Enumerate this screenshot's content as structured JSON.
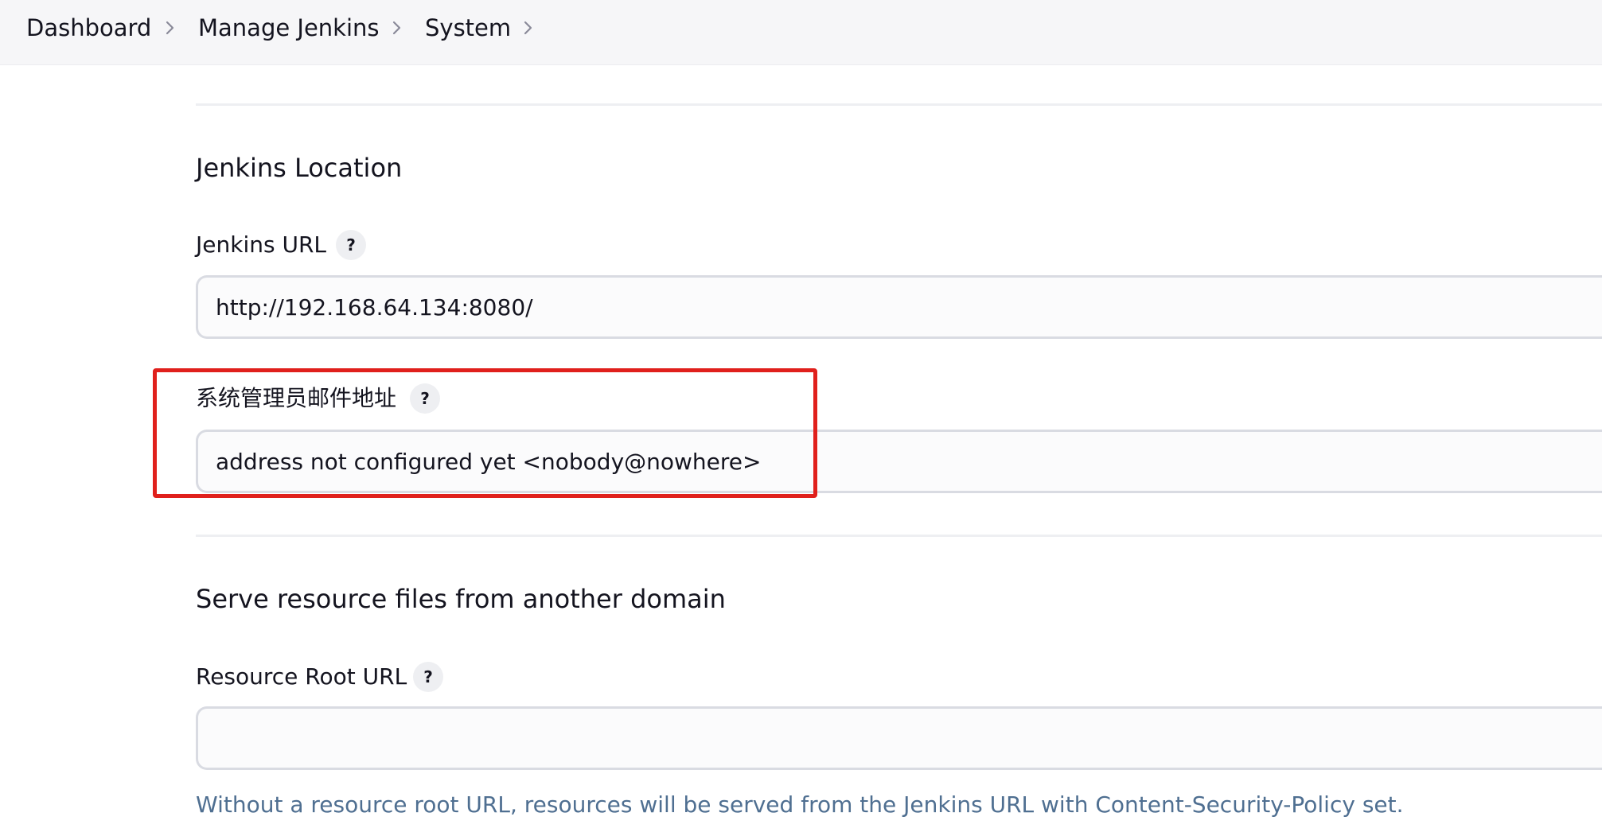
{
  "breadcrumb": {
    "items": [
      {
        "label": "Dashboard"
      },
      {
        "label": "Manage Jenkins"
      },
      {
        "label": "System"
      }
    ]
  },
  "jenkins_location": {
    "title": "Jenkins Location",
    "url_label": "Jenkins URL",
    "url_value": "http://192.168.64.134:8080/",
    "admin_email_label": "系统管理员邮件地址",
    "admin_email_value": "address not configured yet <nobody@nowhere>",
    "help_symbol": "?"
  },
  "resource_domain": {
    "title": "Serve resource files from another domain",
    "root_url_label": "Resource Root URL",
    "root_url_value": "",
    "hint": "Without a resource root URL, resources will be served from the Jenkins URL with Content-Security-Policy set.",
    "help_symbol": "?"
  },
  "colors": {
    "highlight": "#e0201c",
    "hint_text": "#4f6f91",
    "breadcrumb_background": "#f6f6f8"
  },
  "icons": {
    "breadcrumb_separator": "chevron-right-icon",
    "help": "question-mark-icon"
  }
}
